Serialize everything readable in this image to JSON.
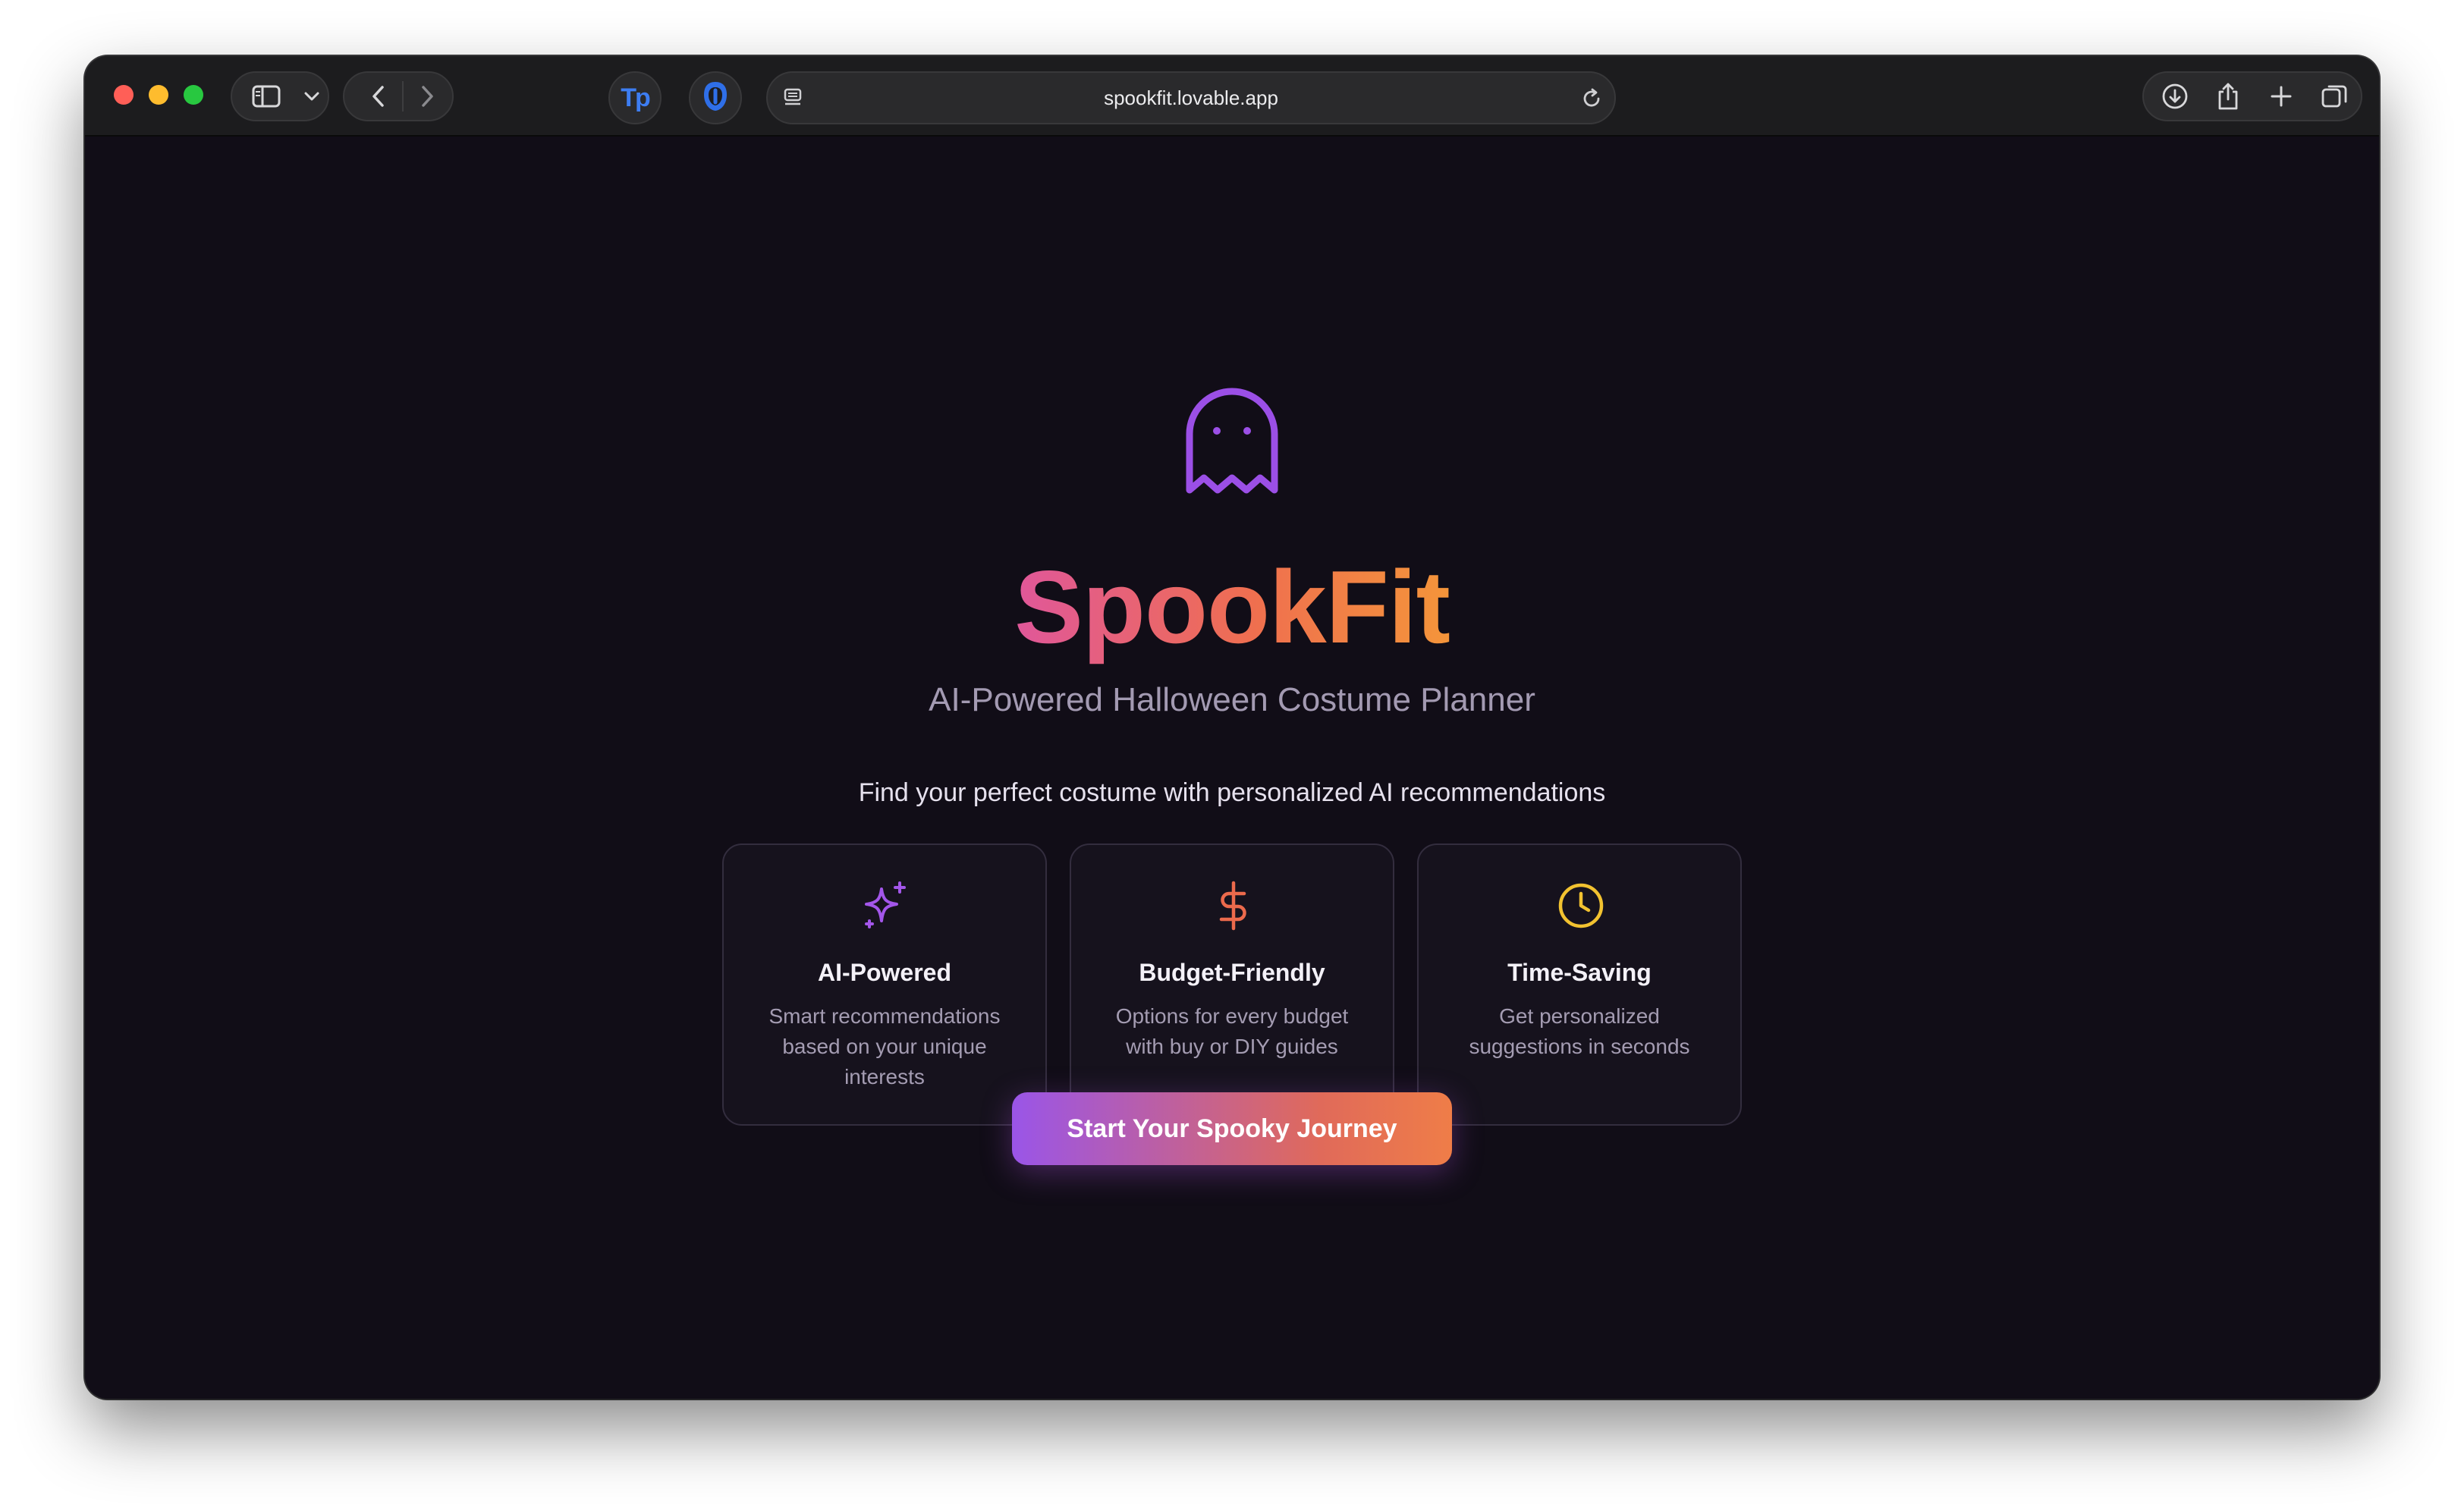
{
  "browser": {
    "url": "spookfit.lovable.app",
    "extension_tp_label": "Tp",
    "icons": [
      "sidebar-icon",
      "chevron-down-icon",
      "back-icon",
      "forward-icon",
      "tp-extension-icon",
      "shield-extension-icon",
      "page-icon",
      "reload-icon",
      "download-icon",
      "share-icon",
      "new-tab-icon",
      "tab-overview-icon"
    ]
  },
  "hero": {
    "logo_icon": "ghost-icon",
    "title": "SpookFit",
    "subtitle": "AI-Powered Halloween Costume Planner",
    "intro": "Find your perfect costume with personalized AI recommendations"
  },
  "features": [
    {
      "icon": "sparkles-icon",
      "title": "AI-Powered",
      "description": "Smart recommendations based on your unique interests"
    },
    {
      "icon": "dollar-icon",
      "title": "Budget-Friendly",
      "description": "Options for every budget with buy or DIY guides"
    },
    {
      "icon": "clock-icon",
      "title": "Time-Saving",
      "description": "Get personalized suggestions in seconds"
    }
  ],
  "cta": {
    "label": "Start Your Spooky Journey"
  },
  "colors": {
    "background": "#110d17",
    "accent_purple": "#9a55e8",
    "accent_orange": "#ef7d48",
    "accent_pink": "#e0579a",
    "accent_yellow": "#f2c230"
  }
}
